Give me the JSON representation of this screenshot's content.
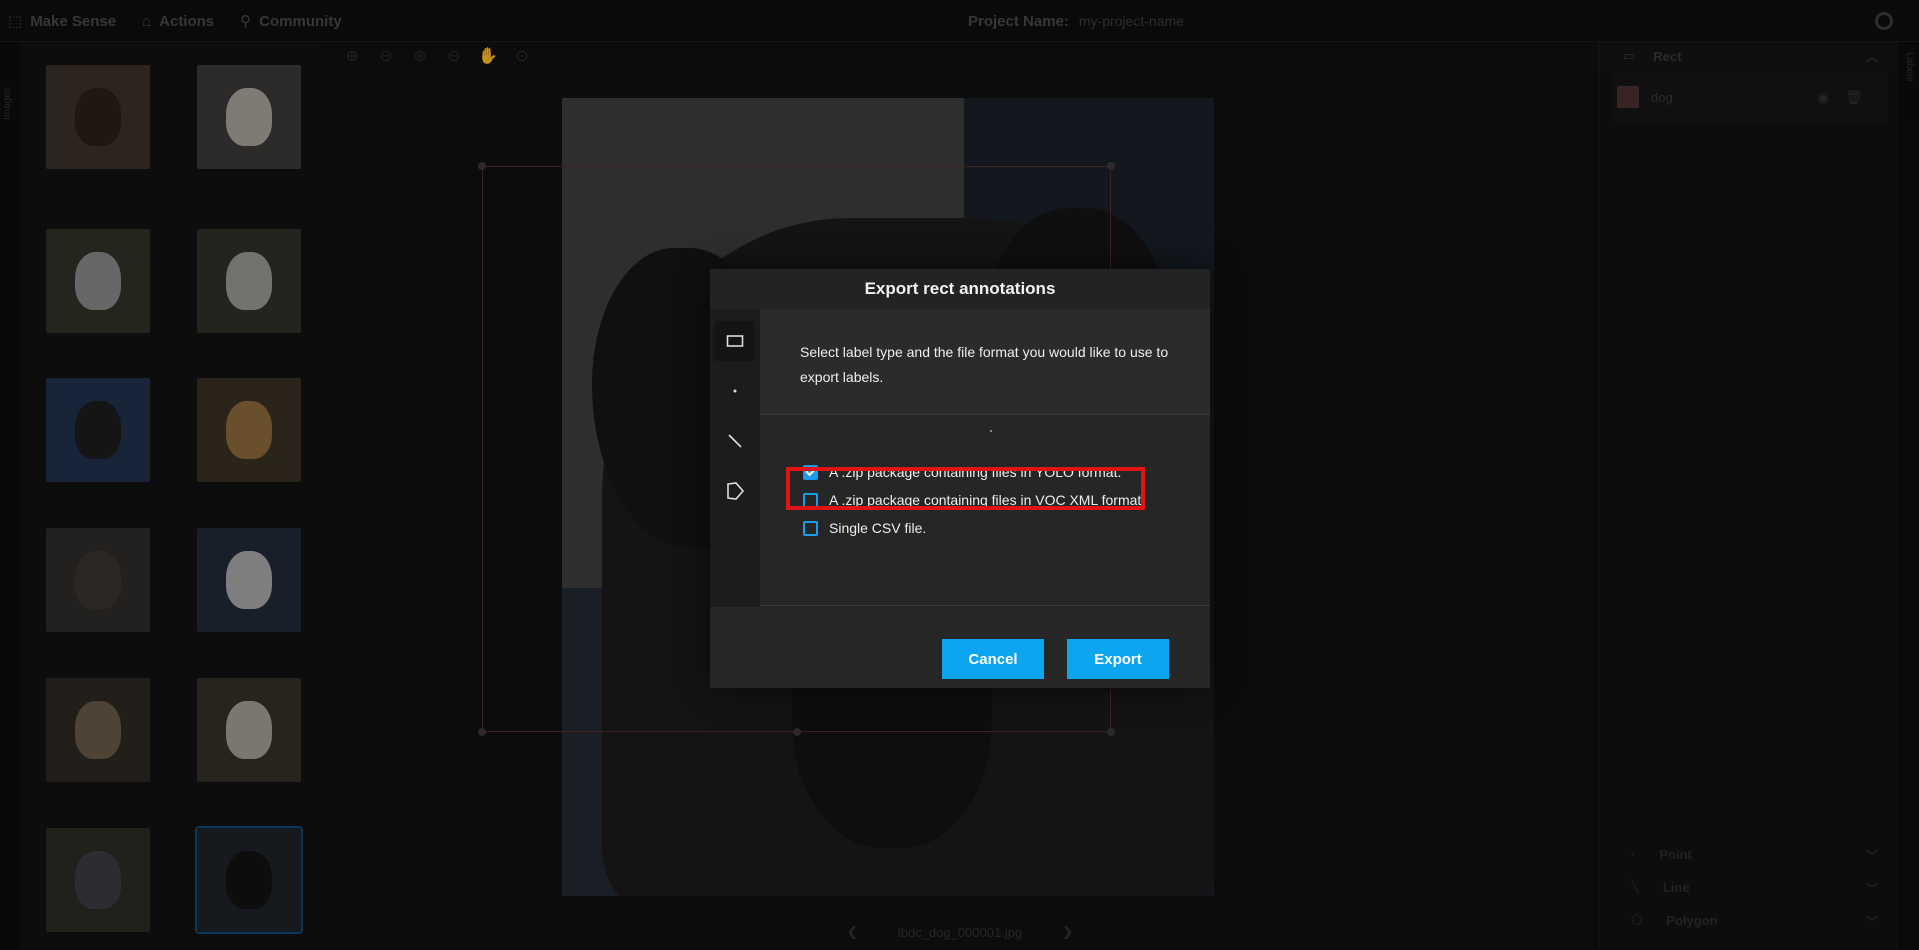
{
  "topbar": {
    "app_name": "Make Sense",
    "menu": [
      {
        "label": "Actions"
      },
      {
        "label": "Community"
      }
    ],
    "project_label": "Project Name:",
    "project_value": "my-project-name"
  },
  "left_tab": {
    "label": "Images"
  },
  "right_tab": {
    "label": "Labels"
  },
  "thumbnails": [
    {
      "bg": "#3a3228",
      "face": "#2a2119"
    },
    {
      "bg": "#3c3a38",
      "face": "#a9a49c"
    },
    {
      "bg": "#2e3326",
      "face": "#8a8a8a"
    },
    {
      "bg": "#2f3127",
      "face": "#9a9894"
    },
    {
      "bg": "#20304a",
      "face": "#1c1c1c"
    },
    {
      "bg": "#3a3024",
      "face": "#8e6a3c"
    },
    {
      "bg": "#2e2c2a",
      "face": "#3a3530"
    },
    {
      "bg": "#22293a",
      "face": "#a8a8a8"
    },
    {
      "bg": "#2e2a24",
      "face": "#6a5a48"
    },
    {
      "bg": "#333026",
      "face": "#a49e94"
    },
    {
      "bg": "#2a2d24",
      "face": "#3a3d44"
    },
    {
      "bg": "#1e2228",
      "face": "#121212"
    }
  ],
  "editor": {
    "filename": "lbdc_dog_000001.jpg"
  },
  "right_panel": {
    "rect_header": "Rect",
    "label_name": "dog",
    "sections": [
      {
        "label": "Point"
      },
      {
        "label": "Line"
      },
      {
        "label": "Polygon"
      }
    ]
  },
  "modal": {
    "title": "Export rect annotations",
    "description": "Select label type and the file format you would like to use to export labels.",
    "options": [
      {
        "label": "A .zip package containing files in YOLO format.",
        "checked": true
      },
      {
        "label": "A .zip package containing files in VOC XML format.",
        "checked": false
      },
      {
        "label": "Single CSV file.",
        "checked": false
      }
    ],
    "cancel_label": "Cancel",
    "export_label": "Export"
  },
  "colors": {
    "accent": "#0ea5f0",
    "highlight": "#e01414",
    "modal_bg": "#262626"
  }
}
